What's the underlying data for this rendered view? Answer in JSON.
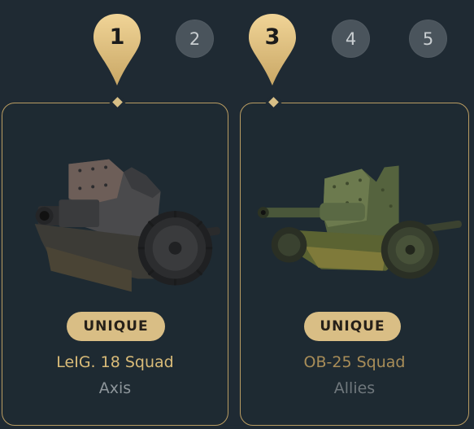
{
  "steps": {
    "items": [
      {
        "label": "1",
        "state": "selected"
      },
      {
        "label": "2",
        "state": "default"
      },
      {
        "label": "3",
        "state": "selected"
      },
      {
        "label": "4",
        "state": "default"
      },
      {
        "label": "5",
        "state": "default"
      }
    ]
  },
  "cards": [
    {
      "badge": "UNIQUE",
      "name": "LeIG. 18 Squad",
      "faction": "Axis",
      "name_color": "#d9bb78"
    },
    {
      "badge": "UNIQUE",
      "name": "OB-25 Squad",
      "faction": "Allies",
      "name_color": "#a88d58"
    }
  ],
  "colors": {
    "accent_gold": "#d9be85",
    "card_border": "#b99c62",
    "background": "#1f2a33",
    "step_default": "#4a545c"
  }
}
